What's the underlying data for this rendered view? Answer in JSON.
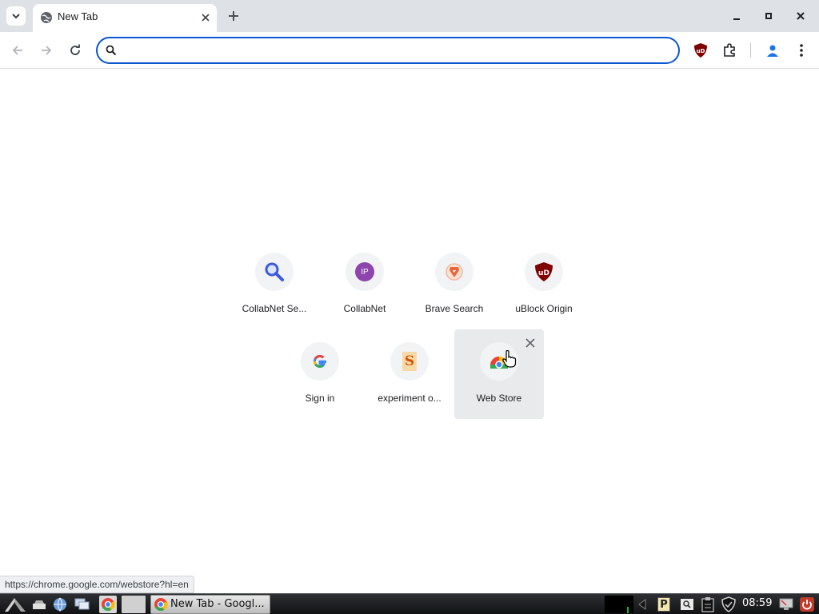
{
  "tabstrip": {
    "tab_title": "New Tab",
    "new_tab_symbol": "+"
  },
  "toolbar": {
    "omnibox_value": "",
    "omnibox_placeholder": ""
  },
  "shortcuts": [
    {
      "label": "CollabNet Se...",
      "icon": "magnifier-icon"
    },
    {
      "label": "CollabNet",
      "icon": "ip-letter-icon",
      "letter": "IP",
      "color": "#8e44ad"
    },
    {
      "label": "Brave Search",
      "icon": "brave-lion-icon",
      "color": "#e8663a"
    },
    {
      "label": "uBlock Origin",
      "icon": "ublock-shield-icon",
      "letter": "uD",
      "color": "#800000"
    },
    {
      "label": "Sign in",
      "icon": "google-g-icon"
    },
    {
      "label": "experiment o...",
      "icon": "s-letter-icon",
      "letter": "S",
      "color": "#e6a23c"
    },
    {
      "label": "Web Store",
      "icon": "chrome-webstore-icon"
    }
  ],
  "status_bubble": "https://chrome.google.com/webstore?hl=en",
  "taskbar": {
    "window_title": "New Tab - Googl...",
    "clock": "08:59",
    "tray_p_letter": "P"
  },
  "colors": {
    "accent": "#0b57d0",
    "tabstrip_bg": "#dee1e6",
    "ublock_red": "#800000"
  }
}
